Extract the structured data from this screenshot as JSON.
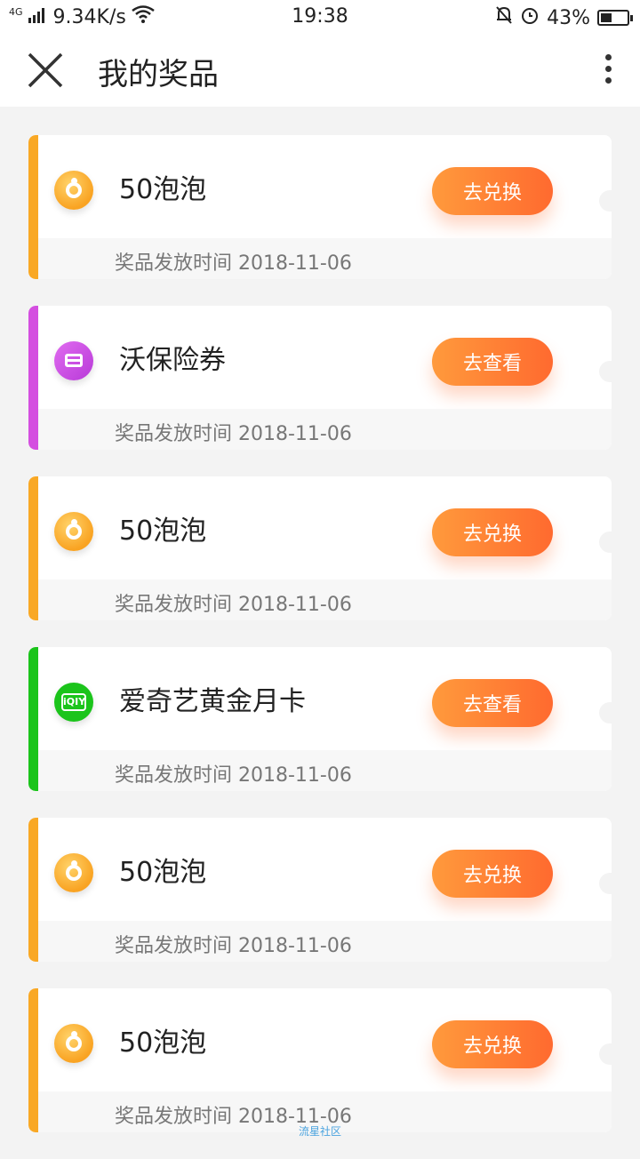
{
  "status_bar": {
    "network": "4G",
    "speed": "9.34K/s",
    "time": "19:38",
    "battery_text": "43%",
    "battery_level": 0.43
  },
  "header": {
    "title": "我的奖品"
  },
  "prizes": [
    {
      "name": "50泡泡",
      "action": "去兑换",
      "date_text": "奖品发放时间 2018-11-06",
      "accent": "#f9a825",
      "icon": "bubble-icon"
    },
    {
      "name": "沃保险券",
      "action": "去查看",
      "date_text": "奖品发放时间 2018-11-06",
      "accent": "#d44fe0",
      "icon": "card-icon"
    },
    {
      "name": "50泡泡",
      "action": "去兑换",
      "date_text": "奖品发放时间 2018-11-06",
      "accent": "#f9a825",
      "icon": "bubble-icon"
    },
    {
      "name": "爱奇艺黄金月卡",
      "action": "去查看",
      "date_text": "奖品发放时间 2018-11-06",
      "accent": "#1bc41b",
      "icon": "iqiyi-icon"
    },
    {
      "name": "50泡泡",
      "action": "去兑换",
      "date_text": "奖品发放时间 2018-11-06",
      "accent": "#f9a825",
      "icon": "bubble-icon"
    },
    {
      "name": "50泡泡",
      "action": "去兑换",
      "date_text": "奖品发放时间 2018-11-06",
      "accent": "#f9a825",
      "icon": "bubble-icon"
    }
  ],
  "watermark": "流星社区"
}
